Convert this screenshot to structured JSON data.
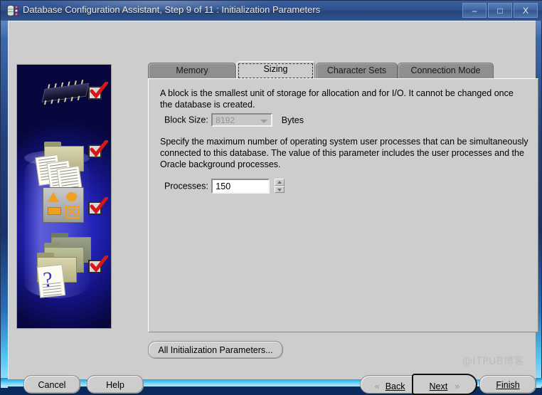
{
  "window": {
    "title": "Database Configuration Assistant, Step 9 of 11 : Initialization Parameters",
    "icon": "database-icon",
    "controls": {
      "minimize": "–",
      "maximize": "□",
      "close": "X"
    }
  },
  "tabs": [
    {
      "label": "Memory",
      "selected": false
    },
    {
      "label": "Sizing",
      "selected": true
    },
    {
      "label": "Character Sets",
      "selected": false
    },
    {
      "label": "Connection Mode",
      "selected": false
    }
  ],
  "panel": {
    "block_description": "A block is the smallest unit of storage for allocation and for I/O. It cannot be changed once the database is created.",
    "block_size_label": "Block Size:",
    "block_size_value": "8192",
    "block_size_units": "Bytes",
    "processes_description": "Specify the maximum number of operating system user processes that can be simultaneously connected to this database. The value of this parameter includes the user processes and the Oracle background processes.",
    "processes_label": "Processes:",
    "processes_value": "150"
  },
  "buttons": {
    "all_parameters": "All Initialization Parameters...",
    "cancel": "Cancel",
    "help": "Help",
    "back": "Back",
    "next": "Next",
    "finish": "Finish",
    "back_chevron": "«",
    "next_chevron": "»"
  },
  "watermark": "@ITPUB博客",
  "colors": {
    "dialog_face": "#cdcdcd",
    "tab_unselected": "#8f8f8f",
    "title_gradient_top": "#3a5f9e",
    "sidebar_blue": "#1717c8",
    "check_red": "#d81616"
  }
}
